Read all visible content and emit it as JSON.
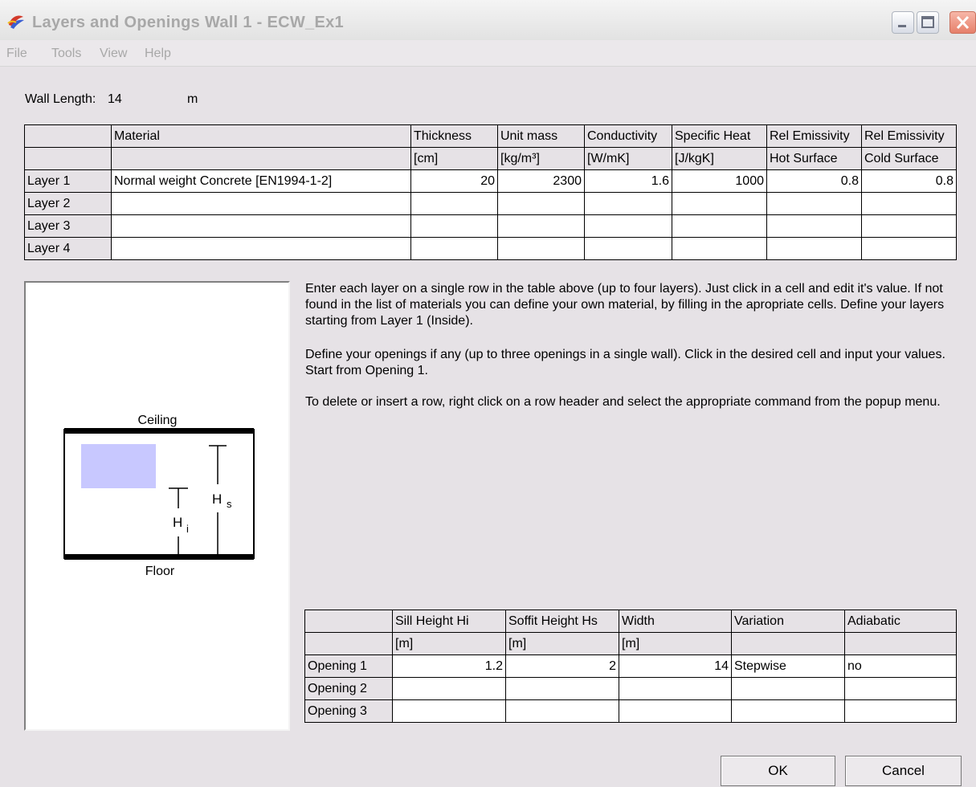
{
  "window": {
    "title": "Layers and Openings Wall 1 - ECW_Ex1"
  },
  "menu": [
    "File",
    "Tools",
    "View",
    "Help"
  ],
  "wall": {
    "label": "Wall Length:",
    "value": "14",
    "unit": "m"
  },
  "layers_table": {
    "headers": [
      "",
      "Material",
      "Thickness",
      "Unit mass",
      "Conductivity",
      "Specific Heat",
      "Rel Emissivity",
      "Rel Emissivity"
    ],
    "units": [
      "",
      "",
      "[cm]",
      "[kg/m³]",
      "[W/mK]",
      "[J/kgK]",
      "Hot Surface",
      "Cold Surface"
    ],
    "rows": [
      [
        "Layer 1",
        "Normal weight Concrete [EN1994-1-2]",
        "20",
        "2300",
        "1.6",
        "1000",
        "0.8",
        "0.8"
      ],
      [
        "Layer 2",
        "",
        "",
        "",
        "",
        "",
        "",
        ""
      ],
      [
        "Layer 3",
        "",
        "",
        "",
        "",
        "",
        "",
        ""
      ],
      [
        "Layer 4",
        "",
        "",
        "",
        "",
        "",
        "",
        ""
      ]
    ]
  },
  "instructions": [
    "Enter each layer on a single row in the table above (up to four layers). Just click in a cell and edit it's value. If not found in the list of materials you can define your own material, by filling in the apropriate cells. Define your layers starting from Layer 1 (Inside).",
    "Define your openings if any (up to three openings in a single wall). Click in the desired cell and input your values. Start from Opening 1.",
    "To delete or insert a row, right click on a row header and select the appropriate command from the popup menu."
  ],
  "diagram": {
    "ceiling": "Ceiling",
    "floor": "Floor",
    "hs_main": "H",
    "hs_sub": "s",
    "hi_main": "H",
    "hi_sub": "i",
    "opening_color": "#c8c8ff"
  },
  "openings_table": {
    "headers": [
      "",
      "Sill Height Hi",
      "Soffit Height Hs",
      "Width",
      "Variation",
      "Adiabatic"
    ],
    "units": [
      "",
      "[m]",
      "[m]",
      "[m]",
      "",
      ""
    ],
    "rows": [
      [
        "Opening 1",
        "1.2",
        "2",
        "14",
        "Stepwise",
        "no"
      ],
      [
        "Opening 2",
        "",
        "",
        "",
        "",
        ""
      ],
      [
        "Opening 3",
        "",
        "",
        "",
        "",
        ""
      ]
    ]
  },
  "buttons": {
    "ok": "OK",
    "cancel": "Cancel"
  }
}
